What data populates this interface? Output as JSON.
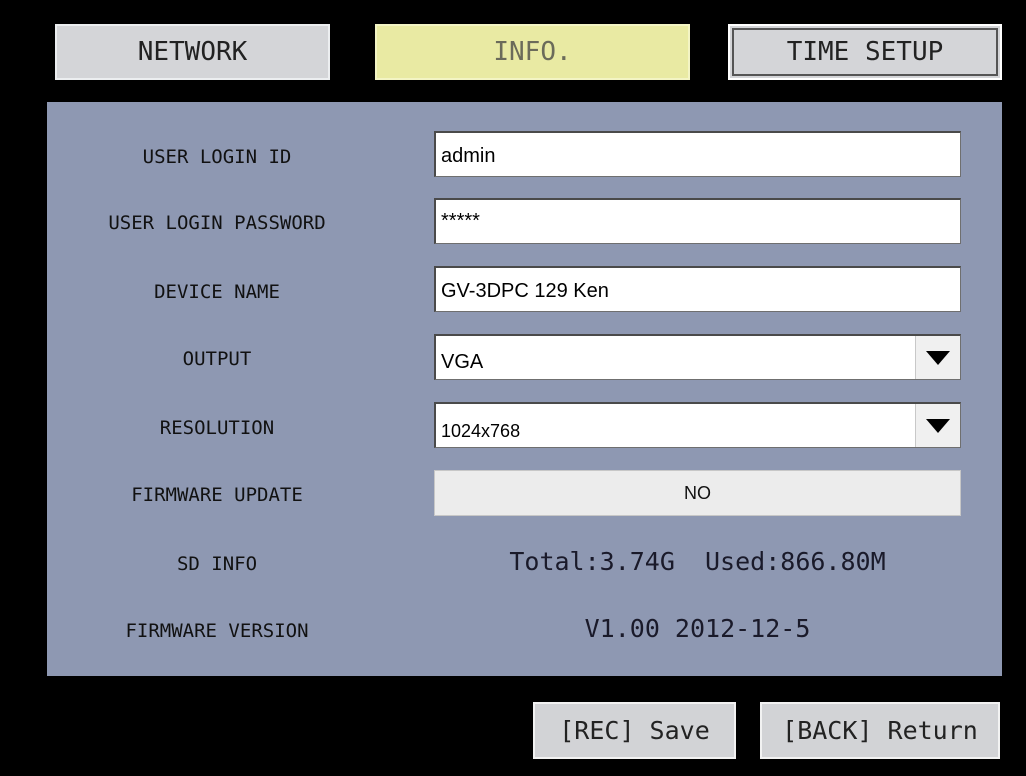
{
  "tabs": {
    "network": "NETWORK",
    "info": "INFO.",
    "time_setup": "TIME SETUP"
  },
  "form": {
    "user_login_id": {
      "label": "USER LOGIN ID",
      "value": "admin"
    },
    "user_login_password": {
      "label": "USER LOGIN PASSWORD",
      "value": "*****"
    },
    "device_name": {
      "label": "DEVICE NAME",
      "value": "GV-3DPC 129 Ken"
    },
    "output": {
      "label": "OUTPUT",
      "value": "VGA"
    },
    "resolution": {
      "label": "RESOLUTION",
      "value": "1024x768"
    },
    "firmware_update": {
      "label": "FIRMWARE UPDATE",
      "value": "NO"
    },
    "sd_info": {
      "label": "SD INFO",
      "value": "Total:3.74G  Used:866.80M"
    },
    "firmware_version": {
      "label": "FIRMWARE VERSION",
      "value": "V1.00 2012-12-5"
    }
  },
  "buttons": {
    "save": "[REC] Save",
    "return": "[BACK] Return"
  },
  "colors": {
    "background": "#000000",
    "panel": "#8e98b2",
    "tab": "#d4d5d8",
    "tab_active": "#e9eaa3"
  }
}
